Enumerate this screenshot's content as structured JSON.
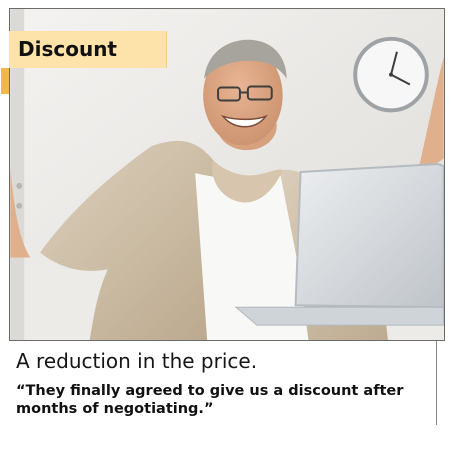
{
  "card": {
    "badge_label": "Discount",
    "definition": "A reduction in the price.",
    "example": "“They finally agreed to give us a discount after months of negotiating.”"
  },
  "photo": {
    "subject": "smiling-man-arms-raised-laptop-photo",
    "colors": {
      "wall": "#efeeec",
      "jacket": "#cdbba1",
      "shirt": "#f6f6f4",
      "laptop": "#d3d7db",
      "badge": "#fde3a9",
      "badge_tab": "#f1b64d"
    }
  }
}
